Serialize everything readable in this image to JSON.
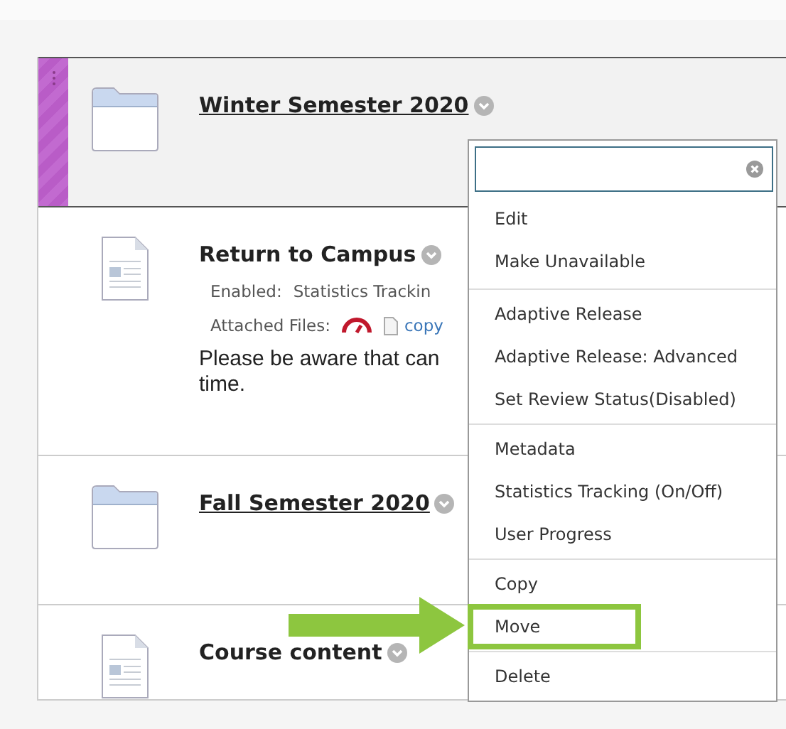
{
  "items": [
    {
      "kind": "folder",
      "title": "Winter Semester 2020",
      "selected": true
    },
    {
      "kind": "document",
      "title": "Return to Campus",
      "selected": false,
      "details": [
        {
          "label": "Enabled:",
          "value": "Statistics Trackin"
        },
        {
          "label": "Attached Files:",
          "link": "copy"
        }
      ],
      "body": [
        "Please be aware that can",
        "time."
      ]
    },
    {
      "kind": "folder",
      "title": "Fall Semester 2020",
      "selected": false
    },
    {
      "kind": "document",
      "title": "Course content",
      "selected": false
    }
  ],
  "menu": {
    "groups": [
      [
        {
          "label": "Edit",
          "highlighted": false
        },
        {
          "label": "Make Unavailable",
          "highlighted": false
        }
      ],
      [
        {
          "label": "Adaptive Release",
          "highlighted": false
        },
        {
          "label": "Adaptive Release: Advanced",
          "highlighted": false
        },
        {
          "label": "Set Review Status(Disabled)",
          "highlighted": false
        }
      ],
      [
        {
          "label": "Metadata",
          "highlighted": false
        },
        {
          "label": "Statistics Tracking (On/Off)",
          "highlighted": false
        },
        {
          "label": "User Progress",
          "highlighted": false
        }
      ],
      [
        {
          "label": "Copy",
          "highlighted": false
        },
        {
          "label": "Move",
          "highlighted": true
        }
      ],
      [
        {
          "label": "Delete",
          "highlighted": false
        }
      ]
    ]
  }
}
